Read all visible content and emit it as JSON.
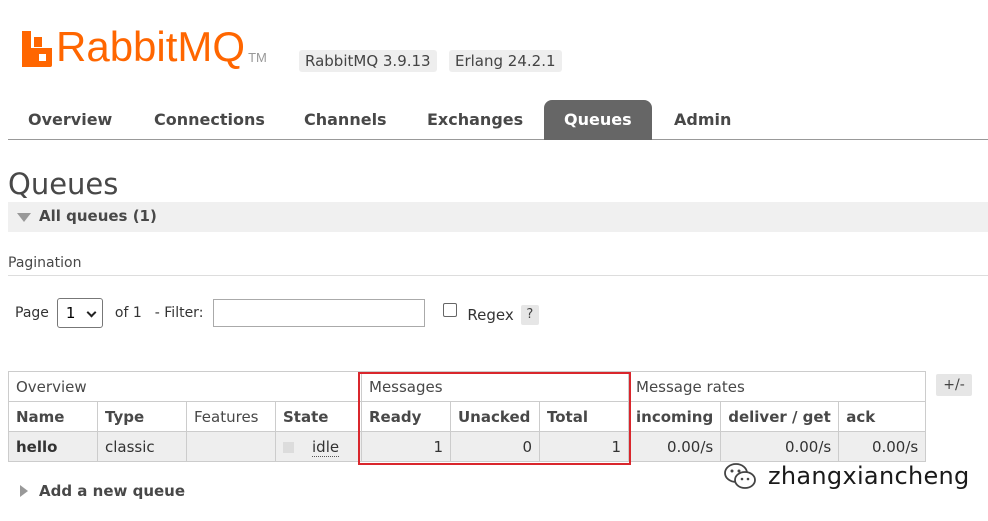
{
  "header": {
    "logo_text": "RabbitMQ",
    "logo_tm": "TM",
    "version_badge": "RabbitMQ 3.9.13",
    "erlang_badge": "Erlang 24.2.1"
  },
  "nav": {
    "tabs": [
      {
        "label": "Overview"
      },
      {
        "label": "Connections"
      },
      {
        "label": "Channels"
      },
      {
        "label": "Exchanges"
      },
      {
        "label": "Queues"
      },
      {
        "label": "Admin"
      }
    ],
    "active": "Queues"
  },
  "page": {
    "title": "Queues",
    "section_label": "All queues (1)",
    "pagination_label": "Pagination"
  },
  "controls": {
    "page_label": "Page",
    "page_value": "1",
    "of_label": "of 1",
    "filter_label": "- Filter:",
    "filter_value": "",
    "regex_label": "Regex",
    "help_label": "?"
  },
  "table": {
    "groups": [
      "Overview",
      "Messages",
      "Message rates"
    ],
    "columns": [
      "Name",
      "Type",
      "Features",
      "State",
      "Ready",
      "Unacked",
      "Total",
      "incoming",
      "deliver / get",
      "ack"
    ],
    "rows": [
      {
        "name": "hello",
        "type": "classic",
        "features": "",
        "state": "idle",
        "ready": "1",
        "unacked": "0",
        "total": "1",
        "incoming": "0.00/s",
        "deliver_get": "0.00/s",
        "ack": "0.00/s"
      }
    ],
    "toggle_label": "+/-"
  },
  "footer": {
    "add_queue_label": "Add a new queue"
  },
  "watermark": {
    "text": "zhangxiancheng"
  },
  "colors": {
    "brand": "#ff6600",
    "active_tab": "#666666",
    "highlight": "#d9262c"
  }
}
